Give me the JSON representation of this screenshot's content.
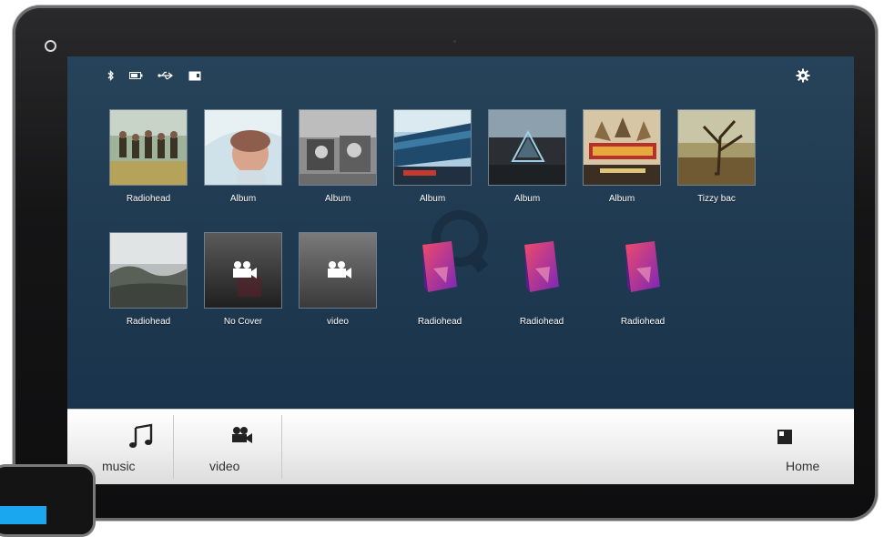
{
  "status_icons": [
    "bluetooth-icon",
    "battery-icon",
    "usb-icon",
    "sd-card-icon"
  ],
  "settings_icon": "gear-icon",
  "row1": [
    {
      "label": "Radiohead",
      "art": "band"
    },
    {
      "label": "Album",
      "art": "baby"
    },
    {
      "label": "Album",
      "art": "bw"
    },
    {
      "label": "Album",
      "art": "train"
    },
    {
      "label": "Album",
      "art": "prism"
    },
    {
      "label": "Album",
      "art": "train-banner"
    },
    {
      "label": "Tizzy bac",
      "art": "tree"
    }
  ],
  "row2": [
    {
      "label": "Radiohead",
      "art": "landscape"
    },
    {
      "label": "No Cover",
      "art": "video-dark"
    },
    {
      "label": "video",
      "art": "video-grey"
    },
    {
      "label": "Radiohead",
      "art": "doc"
    },
    {
      "label": "Radiohead",
      "art": "doc"
    },
    {
      "label": "Radiohead",
      "art": "doc"
    }
  ],
  "dock": {
    "music_label": "music",
    "video_label": "video",
    "home_label": "Home"
  },
  "colors": {
    "screen_bg": "#1f3a50",
    "dock_bg": "#eeeeee",
    "doc_pink": "#e0337a",
    "doc_purple": "#8b2fc0",
    "accent_blue": "#1aa7f0"
  }
}
